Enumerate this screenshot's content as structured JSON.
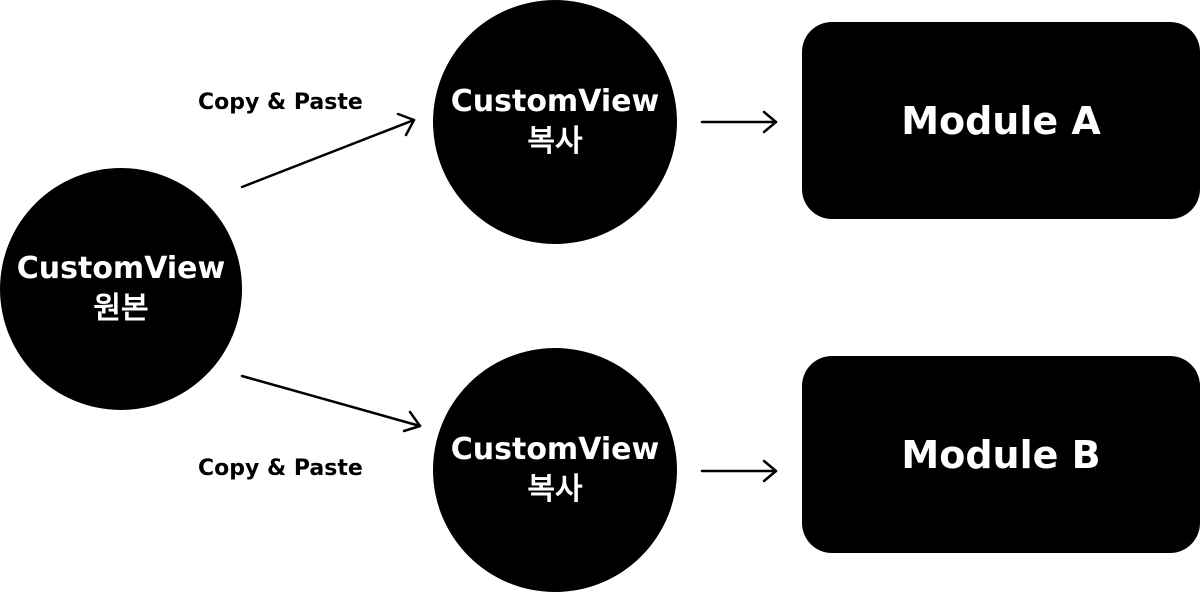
{
  "colors": {
    "node_fill": "#000000",
    "node_text": "#ffffff",
    "edge": "#000000",
    "background": "#ffffff"
  },
  "nodes": {
    "original": {
      "line1": "CustomView",
      "line2": "원본"
    },
    "copy_top": {
      "line1": "CustomView",
      "line2": "복사"
    },
    "copy_bottom": {
      "line1": "CustomView",
      "line2": "복사"
    },
    "module_a": {
      "label": "Module A"
    },
    "module_b": {
      "label": "Module B"
    }
  },
  "edges": {
    "top_label": "Copy & Paste",
    "bottom_label": "Copy & Paste"
  }
}
